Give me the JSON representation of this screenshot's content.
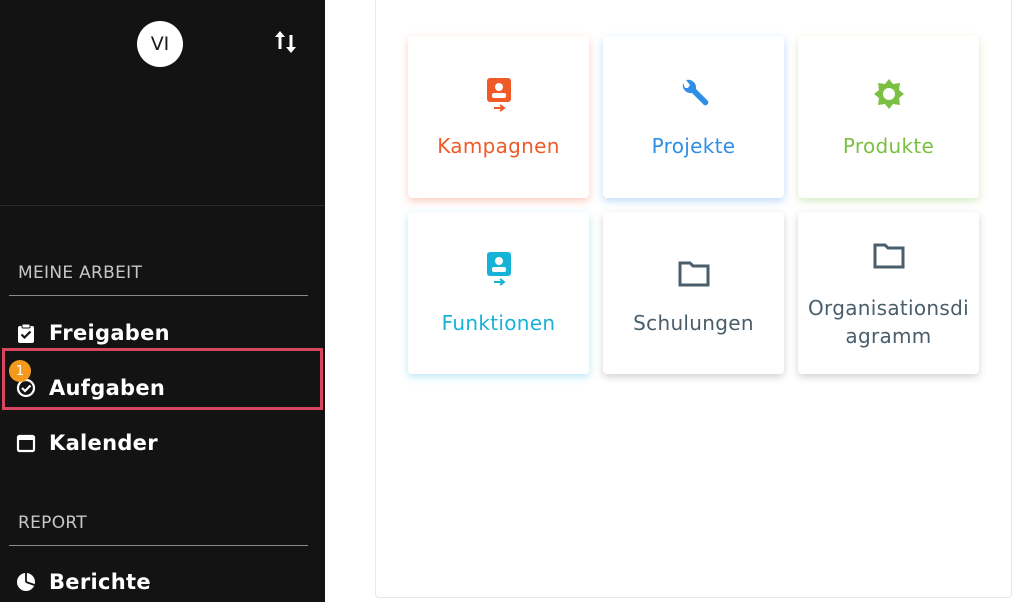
{
  "sidebar": {
    "avatar_initials": "VI",
    "sections": [
      {
        "title": "MEINE ARBEIT",
        "items": [
          {
            "label": "Freigaben",
            "icon": "clipboard-check-icon"
          },
          {
            "label": "Aufgaben",
            "icon": "check-circle-icon",
            "badge": "1",
            "highlighted": true
          },
          {
            "label": "Kalender",
            "icon": "calendar-icon"
          }
        ]
      },
      {
        "title": "REPORT",
        "items": [
          {
            "label": "Berichte",
            "icon": "pie-chart-icon"
          }
        ]
      }
    ]
  },
  "tiles": [
    {
      "label": "Kampagnen",
      "icon": "badge-card-icon",
      "color": "#f05a28"
    },
    {
      "label": "Projekte",
      "icon": "wrench-icon",
      "color": "#2f8ee6"
    },
    {
      "label": "Produkte",
      "icon": "gear-icon",
      "color": "#7cc043"
    },
    {
      "label": "Funktionen",
      "icon": "badge-card-icon",
      "color": "#17b3d6"
    },
    {
      "label": "Schulungen",
      "icon": "folder-icon",
      "color": "#4a5d6b"
    },
    {
      "label": "Organisationsdi",
      "label_line2": "agramm",
      "icon": "folder-icon",
      "color": "#4a5d6b"
    }
  ],
  "colors": {
    "sidebar_bg": "#131313",
    "highlight_border": "#d8455f",
    "badge": "#f39a1e"
  }
}
